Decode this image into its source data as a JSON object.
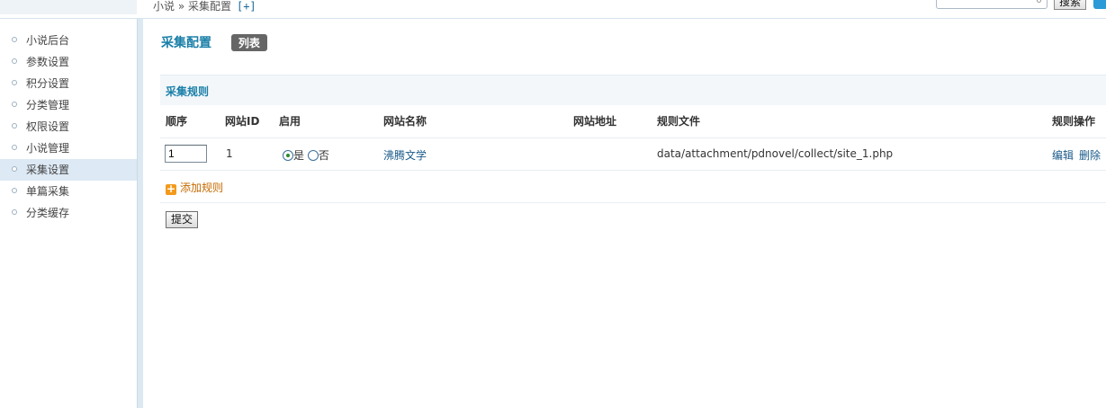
{
  "breadcrumb": {
    "text": "小说 » 采集配置",
    "add_label": "[+]"
  },
  "search": {
    "button_label": "搜索",
    "placeholder": ""
  },
  "sidebar": {
    "items": [
      {
        "label": "小说后台",
        "active": false
      },
      {
        "label": "参数设置",
        "active": false
      },
      {
        "label": "积分设置",
        "active": false
      },
      {
        "label": "分类管理",
        "active": false
      },
      {
        "label": "权限设置",
        "active": false
      },
      {
        "label": "小说管理",
        "active": false
      },
      {
        "label": "采集设置",
        "active": true
      },
      {
        "label": "单篇采集",
        "active": false
      },
      {
        "label": "分类缓存",
        "active": false
      }
    ]
  },
  "main": {
    "title": "采集配置",
    "tab_label": "列表",
    "section_title": "采集规则",
    "columns": [
      "顺序",
      "网站ID",
      "启用",
      "网站名称",
      "网站地址",
      "规则文件",
      "规则操作"
    ],
    "rows": [
      {
        "order": "1",
        "site_id": "1",
        "enabled_yes": "是",
        "enabled_no": "否",
        "site_name": "沸腾文学",
        "site_url": "",
        "rule_file": "data/attachment/pdnovel/collect/site_1.php",
        "edit_label": "编辑",
        "delete_label": "删除"
      }
    ],
    "add_rule_label": "添加规则",
    "submit_label": "提交"
  },
  "colors": {
    "accent": "#1a7fa8",
    "sidebar_active": "#dde9f4",
    "add_rule": "#c56a00"
  }
}
